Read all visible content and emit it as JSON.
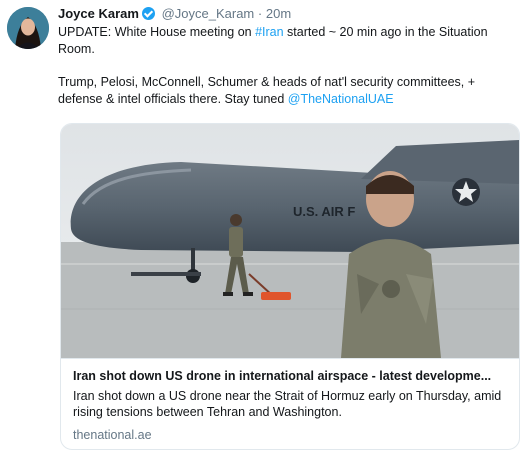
{
  "tweet": {
    "author_name": "Joyce Karam",
    "handle": "@Joyce_Karam",
    "separator": "·",
    "time": "20m",
    "line1_prefix": "UPDATE: White House meeting on ",
    "hashtag": "#Iran",
    "line1_suffix": " started ~ 20 min ago in the Situation Room.",
    "para2": "Trump, Pelosi, McConnell, Schumer & heads of nat'l security committees, + defense & intel officials there. Stay tuned ",
    "mention": "@TheNationalUAE"
  },
  "card": {
    "title": "Iran shot down US drone in international airspace - latest developme...",
    "description": "Iran shot down a US drone near the Strait of Hormuz early on Thursday, amid rising tensions between Tehran and Washington.",
    "domain": "thenational.ae",
    "aircraft_text": "U.S. AIR F"
  }
}
